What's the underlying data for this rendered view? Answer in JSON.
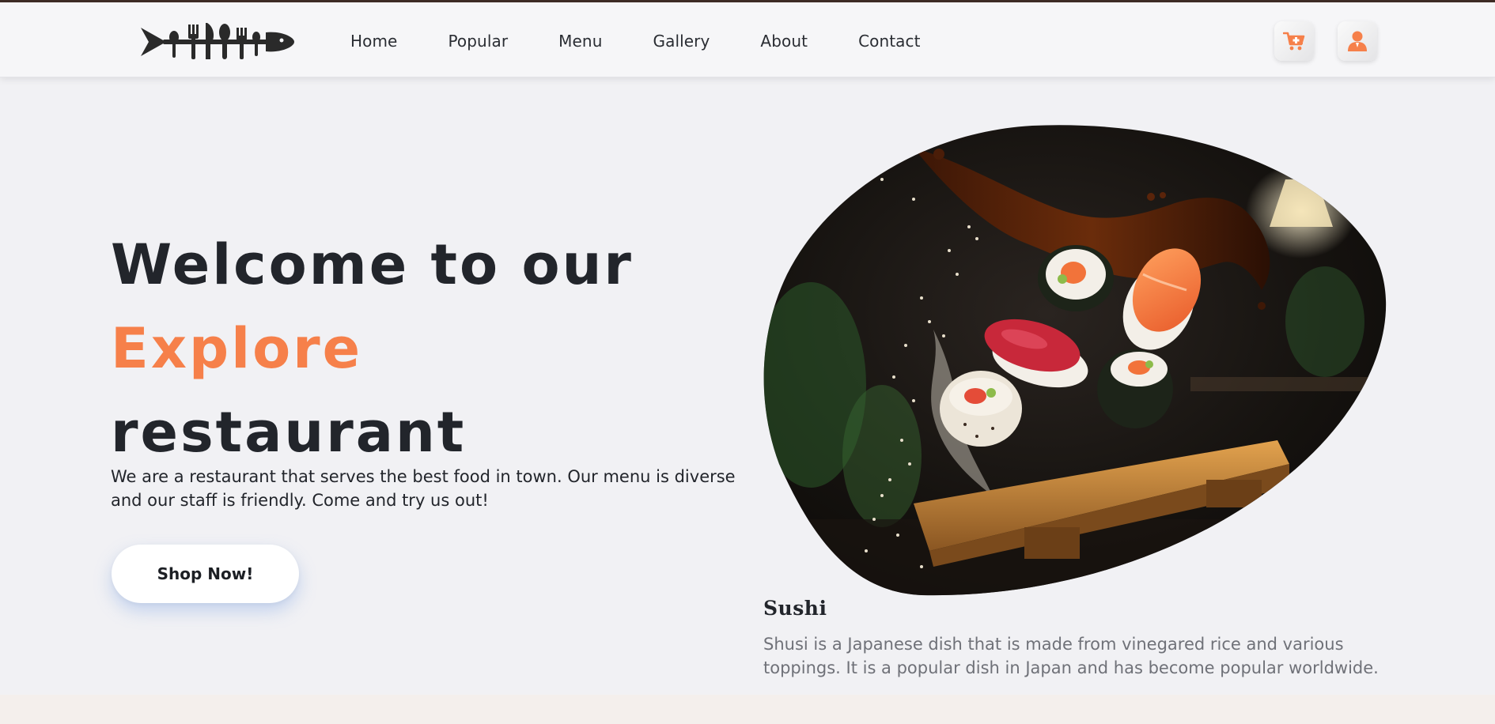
{
  "nav": {
    "items": [
      {
        "label": "Home"
      },
      {
        "label": "Popular"
      },
      {
        "label": "Menu"
      },
      {
        "label": "Gallery"
      },
      {
        "label": "About"
      },
      {
        "label": "Contact"
      }
    ],
    "icons": [
      "logo-fish-cutlery-icon",
      "cart-plus-icon",
      "user-icon"
    ]
  },
  "hero": {
    "title_line1": "Welcome to our",
    "title_line2": "Explore",
    "title_line3": "restaurant",
    "description": "We are a restaurant that serves the best food in town. Our menu is diverse and our staff is friendly. Come and try us out!",
    "cta_label": "Shop Now!"
  },
  "feature": {
    "name": "Sushi",
    "description": "Shusi is a Japanese dish that is made from vinegared rice and various toppings. It is a popular dish in Japan and has become popular worldwide."
  },
  "colors": {
    "accent": "#f6804a",
    "text": "#22252b",
    "background": "#f1f1f4",
    "muted_text": "#6f7178"
  }
}
